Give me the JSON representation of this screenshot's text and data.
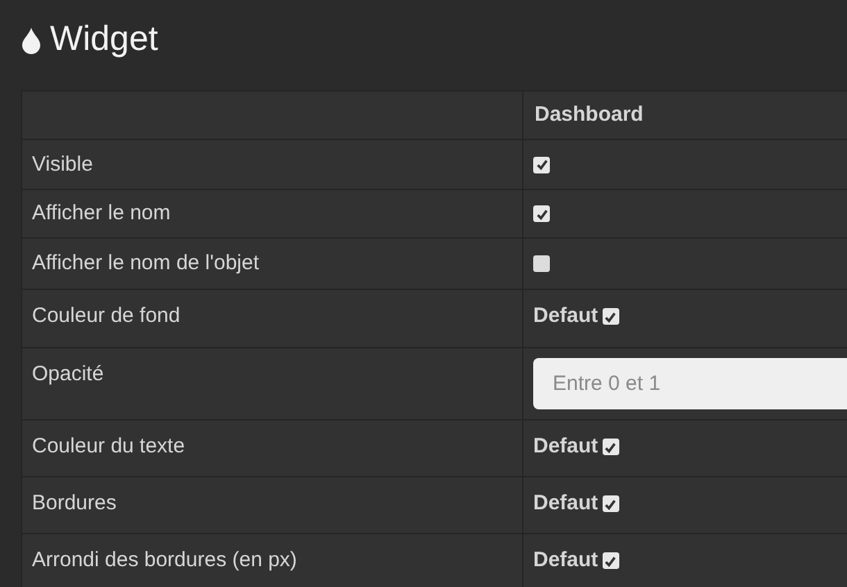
{
  "title": "Widget",
  "table": {
    "columns": [
      "",
      "Dashboard"
    ],
    "rows": [
      {
        "label": "Visible",
        "kind": "checkbox",
        "checked": true
      },
      {
        "label": "Afficher le nom",
        "kind": "checkbox",
        "checked": true
      },
      {
        "label": "Afficher le nom de l'objet",
        "kind": "checkbox",
        "checked": false
      },
      {
        "label": "Couleur de fond",
        "kind": "default",
        "text": "Defaut",
        "checked": true
      },
      {
        "label": "Opacité",
        "kind": "input",
        "placeholder": "Entre 0 et 1"
      },
      {
        "label": "Couleur du texte",
        "kind": "default",
        "text": "Defaut",
        "checked": true
      },
      {
        "label": "Bordures",
        "kind": "default",
        "text": "Defaut",
        "checked": true
      },
      {
        "label": "Arrondi des bordures (en px)",
        "kind": "default",
        "text": "Defaut",
        "checked": true
      }
    ]
  }
}
